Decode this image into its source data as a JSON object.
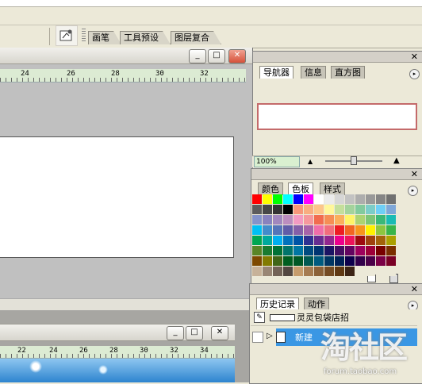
{
  "palette_well": {
    "tabs": [
      {
        "label": "画笔"
      },
      {
        "label": "工具预设"
      },
      {
        "label": "图层复合"
      }
    ]
  },
  "document1": {
    "ruler_ticks": [
      "24",
      "26",
      "28",
      "30",
      "32"
    ]
  },
  "document2": {
    "ruler_ticks": [
      "22",
      "24",
      "26",
      "28",
      "30",
      "32",
      "34"
    ]
  },
  "navigator_panel": {
    "tabs": [
      {
        "label": "导航器",
        "active": true
      },
      {
        "label": "信息",
        "active": false
      },
      {
        "label": "直方图",
        "active": false
      }
    ],
    "zoom": "100%"
  },
  "swatches_panel": {
    "tabs": [
      {
        "label": "颜色",
        "active": false
      },
      {
        "label": "色板",
        "active": true
      },
      {
        "label": "样式",
        "active": false
      }
    ],
    "colors": [
      "#ff0000",
      "#ffff00",
      "#00ff00",
      "#00ffff",
      "#0000ff",
      "#ff00ff",
      "#ffffff",
      "#ebebeb",
      "#d6d6d6",
      "#c2c2c2",
      "#adadad",
      "#999999",
      "#858585",
      "#707070",
      "#5c5c5c",
      "#474747",
      "#333333",
      "#000000",
      "#f7977a",
      "#f9ad81",
      "#fdc68a",
      "#fff79a",
      "#c4df9b",
      "#a3d39c",
      "#82ca9d",
      "#7bcdc8",
      "#6ecff6",
      "#7ea7d8",
      "#8493ca",
      "#8882be",
      "#a187be",
      "#bc8dbf",
      "#f49ac2",
      "#f6989d",
      "#f26c4f",
      "#f68e55",
      "#fbaf5c",
      "#fff467",
      "#acd372",
      "#7cc576",
      "#3bb878",
      "#1abbb4",
      "#00bff3",
      "#438ccb",
      "#5574b9",
      "#605ca8",
      "#855fa8",
      "#a763a8",
      "#f06ea9",
      "#f26d7d",
      "#ed1c24",
      "#f26522",
      "#f7941d",
      "#fff200",
      "#8dc63f",
      "#39b54a",
      "#00a651",
      "#00a99d",
      "#00aeef",
      "#0072bc",
      "#0054a6",
      "#2e3192",
      "#662d91",
      "#92278f",
      "#ec008c",
      "#ed145b",
      "#9e0b0f",
      "#a0410d",
      "#a3620a",
      "#aba000",
      "#598527",
      "#1a7b30",
      "#007236",
      "#00746b",
      "#0076a3",
      "#004b80",
      "#003471",
      "#1b1464",
      "#440e62",
      "#630460",
      "#9e005d",
      "#9e0039",
      "#790000",
      "#7b2e00",
      "#7d4900",
      "#827b00",
      "#406618",
      "#005e20",
      "#005826",
      "#005952",
      "#005b7f",
      "#003663",
      "#002157",
      "#0d004c",
      "#32004b",
      "#4b0049",
      "#7b0046",
      "#7a0026",
      "#c7b299",
      "#998675",
      "#736357",
      "#534741",
      "#c69c6d",
      "#a67c52",
      "#8c6239",
      "#754c24",
      "#603913",
      "#3c2415",
      "#ece9d8",
      "#ece9d8",
      "#ece9d8",
      "#ece9d8"
    ]
  },
  "history_panel": {
    "tabs": [
      {
        "label": "历史记录",
        "active": true
      },
      {
        "label": "动作",
        "active": false
      }
    ],
    "snapshot_name": "灵灵包袋店招",
    "states": [
      {
        "label": "新建",
        "selected": true
      }
    ]
  },
  "watermark": {
    "logo_text": "淘社区",
    "url": "forum.taobao.com"
  }
}
